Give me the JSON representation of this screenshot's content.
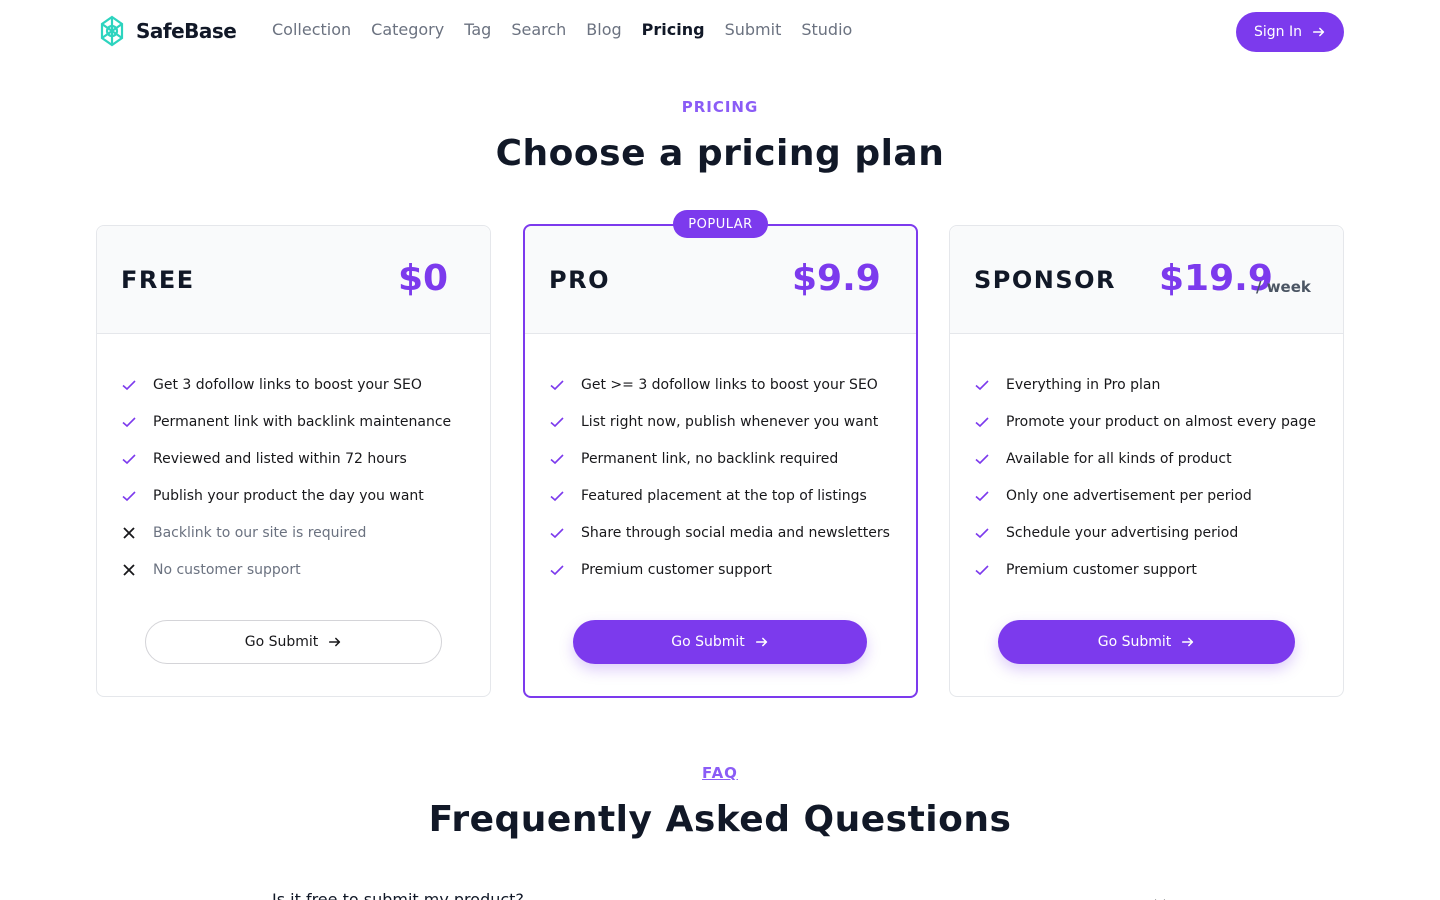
{
  "brand": {
    "name": "SafeBase",
    "accent": "#7c3aed",
    "logo_color": "#2dd4bf"
  },
  "nav": {
    "items": [
      "Collection",
      "Category",
      "Tag",
      "Search",
      "Blog",
      "Pricing",
      "Submit",
      "Studio"
    ],
    "active": "Pricing"
  },
  "header": {
    "signin_label": "Sign In",
    "signin_icon": "arrow-right-icon"
  },
  "pricing": {
    "eyebrow": "PRICING",
    "title": "Choose a pricing plan",
    "plans": [
      {
        "name": "FREE",
        "price": "$0",
        "period": "",
        "badge": "",
        "button": "Go Submit",
        "features": [
          {
            "text": "Get 3 dofollow links to boost your SEO",
            "included": true
          },
          {
            "text": "Permanent link with backlink maintenance",
            "included": true
          },
          {
            "text": "Reviewed and listed within 72 hours",
            "included": true
          },
          {
            "text": "Publish your product the day you want",
            "included": true
          },
          {
            "text": "Backlink to our site is required",
            "included": false
          },
          {
            "text": "No customer support",
            "included": false
          }
        ]
      },
      {
        "name": "PRO",
        "price": "$9.9",
        "period": "",
        "badge": "POPULAR",
        "button": "Go Submit",
        "features": [
          {
            "text": "Get >= 3 dofollow links to boost your SEO",
            "included": true
          },
          {
            "text": "List right now, publish whenever you want",
            "included": true
          },
          {
            "text": "Permanent link, no backlink required",
            "included": true
          },
          {
            "text": "Featured placement at the top of listings",
            "included": true
          },
          {
            "text": "Share through social media and newsletters",
            "included": true
          },
          {
            "text": "Premium customer support",
            "included": true
          }
        ]
      },
      {
        "name": "SPONSOR",
        "price": "$19.9",
        "period": "/ week",
        "badge": "",
        "button": "Go Submit",
        "features": [
          {
            "text": "Everything in Pro plan",
            "included": true
          },
          {
            "text": "Promote your product on almost every page",
            "included": true
          },
          {
            "text": "Available for all kinds of product",
            "included": true
          },
          {
            "text": "Only one advertisement per period",
            "included": true
          },
          {
            "text": "Schedule your advertising period",
            "included": true
          },
          {
            "text": "Premium customer support",
            "included": true
          }
        ]
      }
    ]
  },
  "faq": {
    "eyebrow": "FAQ",
    "title": "Frequently Asked Questions",
    "first_question": "Is it free to submit my product?"
  }
}
